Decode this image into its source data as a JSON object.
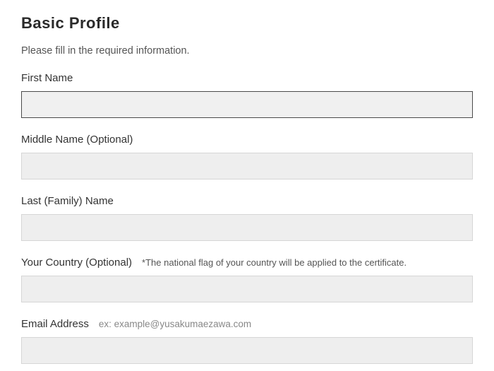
{
  "header": {
    "title": "Basic Profile",
    "subtitle": "Please fill in the required information."
  },
  "fields": {
    "first_name": {
      "label": "First Name",
      "value": ""
    },
    "middle_name": {
      "label": "Middle Name (Optional)",
      "value": ""
    },
    "last_name": {
      "label": "Last (Family) Name",
      "value": ""
    },
    "country": {
      "label": "Your Country (Optional)",
      "note": "*The national flag of your country will be applied to the certificate.",
      "value": ""
    },
    "email": {
      "label": "Email Address",
      "hint": "ex: example@yusakumaezawa.com",
      "value": ""
    }
  }
}
